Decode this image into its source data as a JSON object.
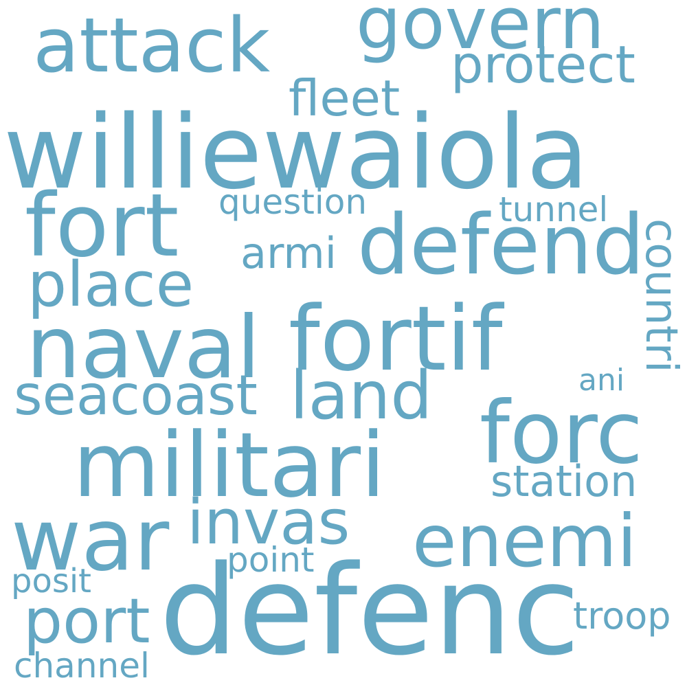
{
  "colors": {
    "word": "#64a7c3",
    "background": "#ffffff"
  },
  "words": {
    "williewaiola": "williewaiola",
    "defenc": "defenc",
    "fortif": "fortif",
    "militari": "militari",
    "naval": "naval",
    "defend": "defend",
    "fort": "fort",
    "govern": "govern",
    "attack": "attack",
    "war": "war",
    "forc": "forc",
    "enemi": "enemi",
    "land": "land",
    "seacoast": "seacoast",
    "place": "place",
    "invas": "invas",
    "protect": "protect",
    "port": "port",
    "fleet": "fleet",
    "station": "station",
    "armi": "armi",
    "countri": "countri",
    "question": "question",
    "tunnel": "tunnel",
    "troop": "troop",
    "point": "point",
    "posit": "posit",
    "channel": "channel",
    "ani": "ani"
  }
}
